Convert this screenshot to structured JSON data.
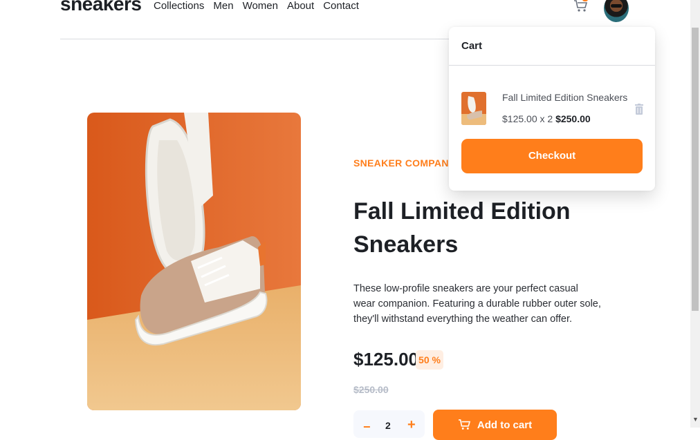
{
  "logo": "sneakers",
  "nav": [
    "Collections",
    "Men",
    "Women",
    "About",
    "Contact"
  ],
  "cart": {
    "title": "Cart",
    "item_name": "Fall Limited Edition Sneakers",
    "item_unit": "$125.00 x 2 ",
    "item_total": "$250.00",
    "checkout_label": "Checkout"
  },
  "product": {
    "company": "SNEAKER COMPANY",
    "title": "Fall Limited Edition Sneakers",
    "description": "These low-profile sneakers are your perfect casual wear companion. Featuring a durable rubber outer sole, they'll withstand everything the weather can offer.",
    "price": "$125.00",
    "discount": "50 %",
    "old_price": "$250.00",
    "quantity": "2",
    "add_label": "Add to cart"
  },
  "colors": {
    "accent": "#ff7e1b",
    "dark": "#1d2025",
    "pale": "#ffeee2"
  }
}
